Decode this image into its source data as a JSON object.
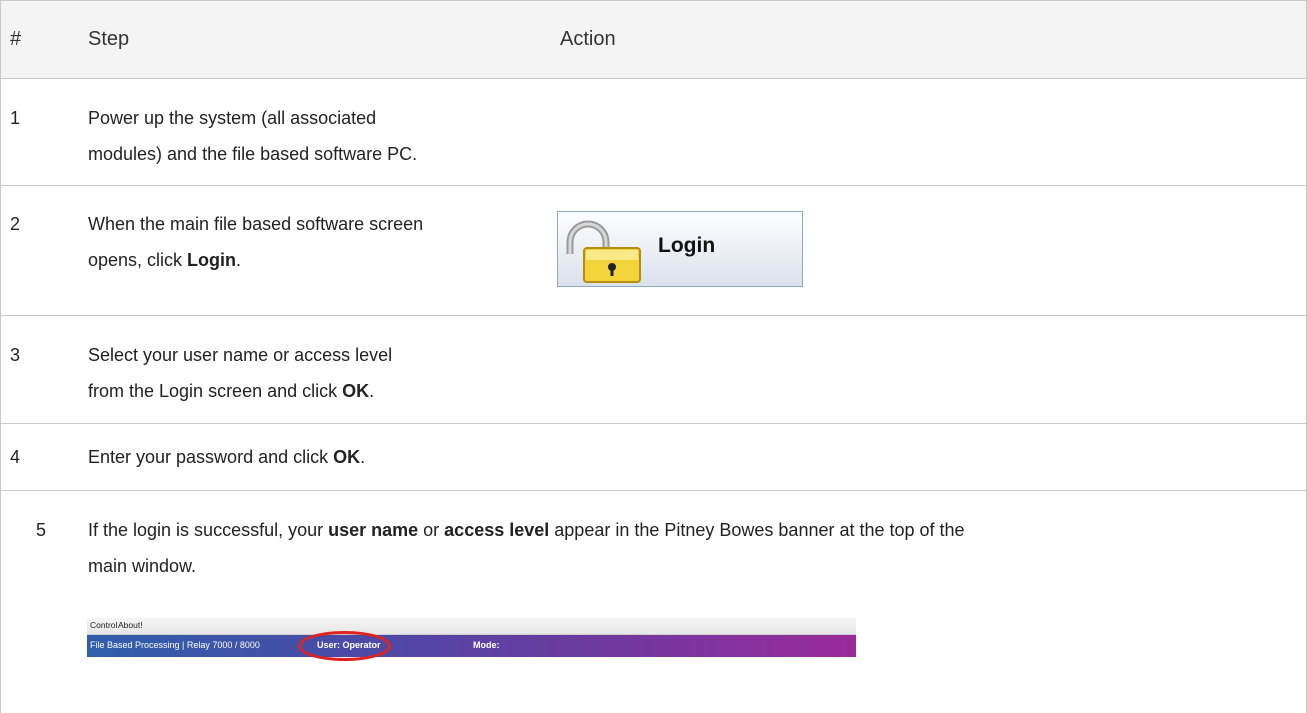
{
  "table": {
    "headers": {
      "num": "#",
      "step": "Step",
      "action": "Action"
    },
    "rows": [
      {
        "num": "1",
        "lines": [
          "Power up the system (all associated",
          "modules) and the file based software PC."
        ]
      },
      {
        "num": "2",
        "line1": "When the main file based software screen",
        "line2_pre": "opens, click ",
        "line2_bold": "Login",
        "line2_post": "."
      },
      {
        "num": "3",
        "line1": "Select your user name or access level",
        "line2_pre": "from the Login screen and click ",
        "line2_bold": "OK",
        "line2_post": "."
      },
      {
        "num": "4",
        "pre": "Enter your password and click ",
        "bold": "OK",
        "post": "."
      },
      {
        "num": "5",
        "pre": "If the login is successful, your ",
        "bold1": "user name",
        "mid": " or ",
        "bold2": "access level",
        "post": " appear in the Pitney Bowes banner at the top of the",
        "line2": "main window."
      }
    ]
  },
  "login_button": {
    "label": "Login",
    "icon": "padlock-icon"
  },
  "banner": {
    "menu": [
      "Control",
      "About!"
    ],
    "title": "File Based Processing | Relay 7000 / 8000",
    "user": "User: Operator",
    "mode": "Mode:",
    "highlight_color": "#e0231f"
  }
}
